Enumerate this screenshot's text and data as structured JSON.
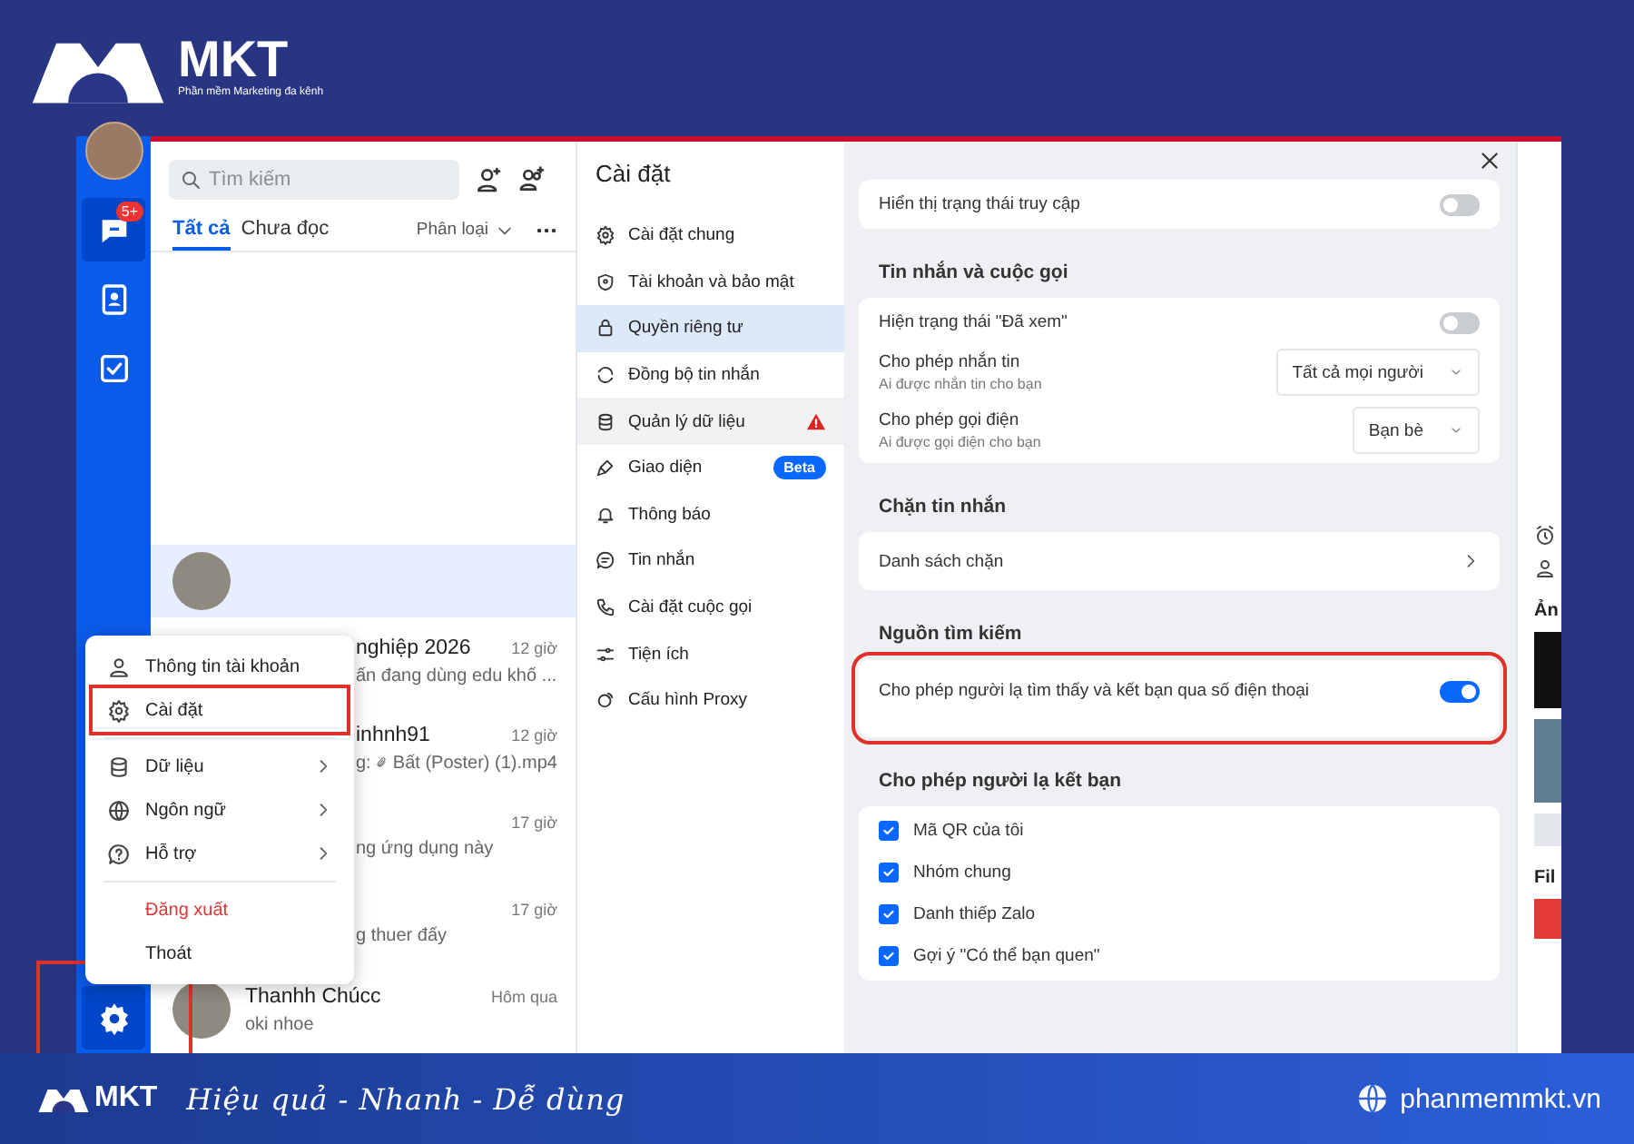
{
  "header": {
    "logo_text": "MKT",
    "tagline": "Phần mềm Marketing đa kênh"
  },
  "rail": {
    "items": [
      {
        "selected": true,
        "badge": "5+"
      },
      {
        "selected": false
      },
      {
        "selected": false
      }
    ],
    "settings": {
      "selected": true,
      "highlighted": true
    }
  },
  "chat_list": {
    "search": {
      "placeholder": "Tìm kiếm"
    },
    "tabs": [
      {
        "label": "Tất cả",
        "selected": true
      },
      {
        "label": "Chưa đọc",
        "selected": false
      }
    ],
    "filter": "Phân loại",
    "conversations": [
      {
        "selected": true,
        "avatar": true
      },
      {
        "selected": false,
        "avatar": false,
        "name": "nghiệp 2026",
        "time": "12 giờ",
        "preview": "ấn đang dùng edu khố ..."
      },
      {
        "selected": false,
        "avatar": false,
        "name": "inhnh91",
        "time": "12 giờ",
        "preview": "g:",
        "attachment": "Bất (Poster) (1).mp4"
      },
      {
        "selected": false,
        "avatar": false,
        "time": "17 giờ",
        "preview": "ng ứng dụng này"
      },
      {
        "selected": false,
        "avatar": false,
        "time": "17 giờ",
        "preview": "g thuer đấy"
      },
      {
        "selected": false,
        "avatar": true,
        "name": "Thanhh Chúcc",
        "time": "Hôm qua",
        "preview": "oki nhoe"
      }
    ]
  },
  "account_menu": {
    "groups": [
      [
        {
          "label": "Thông tin tài khoản",
          "submenu": false,
          "highlighted": false
        },
        {
          "label": "Cài đặt",
          "submenu": false,
          "highlighted": true
        }
      ],
      [
        {
          "label": "Dữ liệu",
          "submenu": true,
          "highlighted": false
        },
        {
          "label": "Ngôn ngữ",
          "submenu": true,
          "highlighted": false
        },
        {
          "label": "Hỗ trợ",
          "submenu": true,
          "highlighted": false
        }
      ],
      [
        {
          "label": "Đăng xuất",
          "danger": true
        },
        {
          "label": "Thoát",
          "danger": false
        }
      ]
    ]
  },
  "settings": {
    "title": "Cài đặt",
    "nav": [
      {
        "label": "Cài đặt chung",
        "selected": false
      },
      {
        "label": "Tài khoản và bảo mật",
        "selected": false
      },
      {
        "label": "Quyền riêng tư",
        "selected": true
      },
      {
        "label": "Đồng bộ tin nhắn",
        "selected": false
      },
      {
        "label": "Quản lý dữ liệu",
        "selected": false,
        "hovered": true,
        "warning": true
      },
      {
        "label": "Giao diện",
        "selected": false,
        "badge": "Beta"
      },
      {
        "label": "Thông báo",
        "selected": false
      },
      {
        "label": "Tin nhắn",
        "selected": false
      },
      {
        "label": "Cài đặt cuộc gọi",
        "selected": false
      },
      {
        "label": "Tiện ích",
        "selected": false
      },
      {
        "label": "Cấu hình Proxy",
        "selected": false
      }
    ],
    "sections": [
      {
        "highlighted": false,
        "rows": [
          {
            "kind": "toggle",
            "label": "Hiển thị trạng thái truy cập",
            "on": false
          }
        ]
      },
      {
        "heading": "Tin nhắn và cuộc gọi",
        "highlighted": false,
        "rows": [
          {
            "kind": "toggle",
            "label": "Hiện trạng thái \"Đã xem\"",
            "on": false
          },
          {
            "kind": "select",
            "label": "Cho phép nhắn tin",
            "hint": "Ai được nhắn tin cho bạn",
            "value": "Tất cả mọi người"
          },
          {
            "kind": "select",
            "label": "Cho phép gọi điện",
            "hint": "Ai được gọi điện cho bạn",
            "value": "Bạn bè"
          }
        ]
      },
      {
        "heading": "Chặn tin nhắn",
        "highlighted": false,
        "rows": [
          {
            "kind": "link",
            "label": "Danh sách chặn"
          }
        ]
      },
      {
        "heading": "Nguồn tìm kiếm",
        "highlighted": true,
        "rows": [
          {
            "kind": "toggle",
            "label": "Cho phép người lạ tìm thấy và kết bạn qua số điện thoại",
            "on": true
          }
        ]
      },
      {
        "heading": "Cho phép người lạ kết bạn",
        "highlighted": false,
        "rows": [
          {
            "kind": "checkbox",
            "label": "Mã QR của tôi",
            "checked": true
          },
          {
            "kind": "checkbox",
            "label": "Nhóm chung",
            "checked": true
          },
          {
            "kind": "checkbox",
            "label": "Danh thiếp Zalo",
            "checked": true
          },
          {
            "kind": "checkbox",
            "label": "Gợi ý \"Có thể bạn quen\"",
            "checked": true
          }
        ]
      }
    ]
  },
  "side_panel": {
    "headings": [
      "Ản",
      "Fil"
    ]
  },
  "footer": {
    "logo_text": "MKT",
    "slogan": "Hiệu quả - Nhanh - Dễ dùng",
    "website": "phanmemmkt.vn"
  }
}
